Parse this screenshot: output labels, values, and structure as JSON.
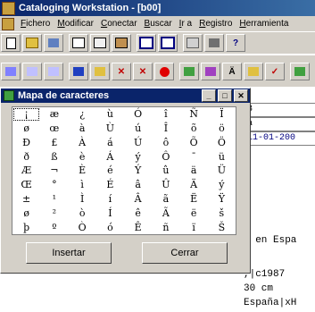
{
  "window": {
    "title": "Cataloging Workstation - [b00]"
  },
  "menu": [
    {
      "u": "F",
      "rest": "ichero"
    },
    {
      "u": "M",
      "rest": "odificar"
    },
    {
      "u": "C",
      "rest": "onectar"
    },
    {
      "u": "B",
      "rest": "uscar"
    },
    {
      "u": "I",
      "rest": "r a"
    },
    {
      "u": "R",
      "rest": "egistro"
    },
    {
      "u": "H",
      "rest": "erramienta"
    }
  ],
  "dialog": {
    "title": "Mapa de caracteres",
    "buttons": {
      "insert": "Insertar",
      "close": "Cerrar"
    },
    "grid": [
      [
        "¡",
        "æ",
        "¿",
        "ù",
        "Ó",
        "î",
        "Ñ",
        "Ï",
        "å"
      ],
      [
        "ø",
        "œ",
        "à",
        "Ù",
        "ú",
        "Î",
        "õ",
        "ö",
        "Å"
      ],
      [
        "Ð",
        "£",
        "À",
        "á",
        "Ú",
        "ô",
        "Õ",
        "Ö",
        "ç"
      ],
      [
        "ð",
        "ß",
        "è",
        "Á",
        "ý",
        "Ô",
        "¯",
        "ü",
        "Ç"
      ],
      [
        "Æ",
        "¬",
        "È",
        "é",
        "Ý",
        "û",
        "ä",
        "Ü",
        "†"
      ],
      [
        "Œ",
        "°",
        "ì",
        "É",
        "â",
        "Û",
        "Ä",
        "ý",
        "°"
      ],
      [
        "±",
        "¹",
        "Ì",
        "í",
        "Â",
        "ã",
        "Ë",
        "Ÿ",
        "ª"
      ],
      [
        "ø",
        "²",
        "ò",
        "Í",
        "ê",
        "Ã",
        "ë",
        "š",
        "ß"
      ],
      [
        "þ",
        "º",
        "Ò",
        "ó",
        "Ê",
        "ñ",
        "ï",
        "Š",
        ""
      ]
    ]
  },
  "record": {
    "field1": "3",
    "field2": "a",
    "field3": "11-01-200",
    "line1": "l en Espa",
    "line2": ",|c1987",
    "line3": "30 cm",
    "line4": "España|xH"
  }
}
